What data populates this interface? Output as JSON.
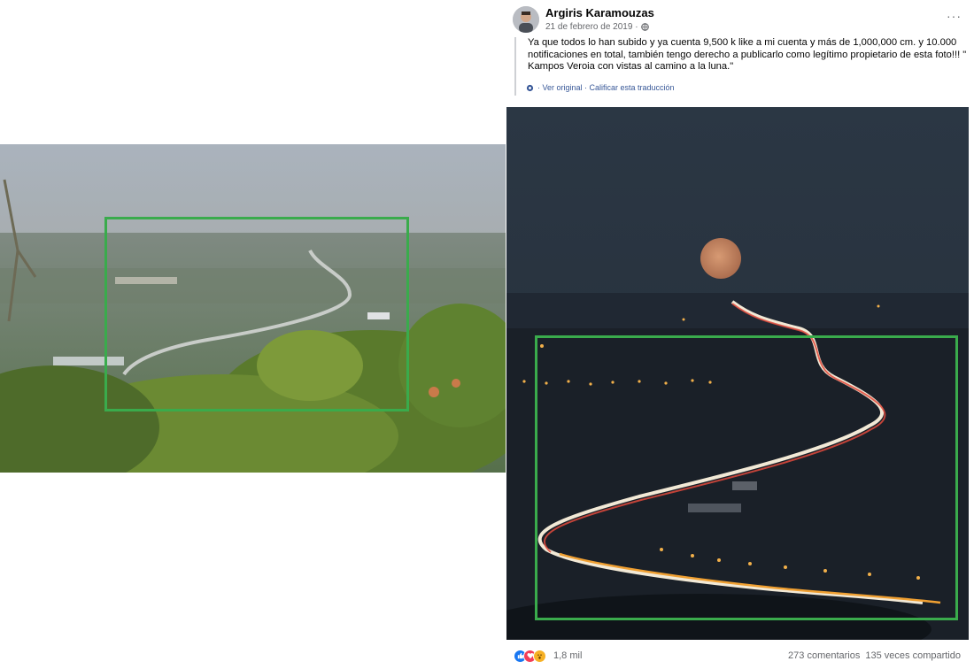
{
  "post": {
    "author": "Argiris Karamouzas",
    "date": "21 de febrero de 2019 ·",
    "more": "···",
    "text": "Ya que todos lo han subido y ya cuenta 9,500 k like a mi cuenta y más de 1,000,000 cm. y 10.000 notificaciones en total, también tengo derecho a publicarlo como legítimo propietario de esta foto!!! \" Kampos Veroia con vistas al camino a la luna.\"",
    "translation_links": "· Ver original · Calificar esta traducción",
    "reaction_count": "1,8 mil",
    "comments": "273 comentarios",
    "shares": "135 veces compartido"
  },
  "icons": {
    "reactions": [
      "like-icon",
      "love-icon",
      "wow-icon"
    ],
    "globe": "globe-icon",
    "gear": "gear-icon"
  },
  "colors": {
    "highlight_box": "#3aab4c",
    "link": "#385898",
    "secondary_text": "#65676b"
  }
}
